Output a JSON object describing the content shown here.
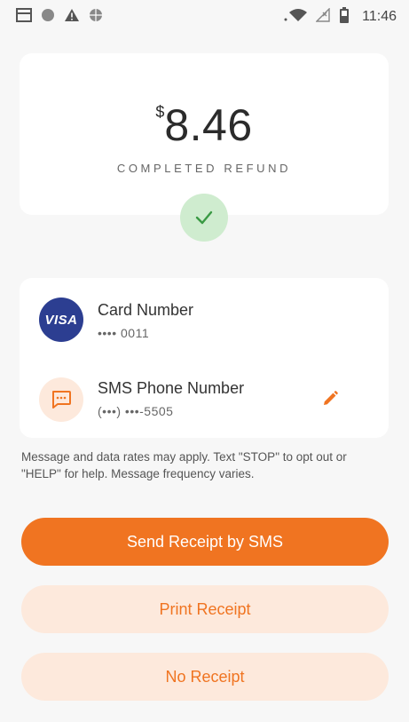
{
  "status_bar": {
    "time": "11:46",
    "icons": [
      "notification-card-icon",
      "dot-icon",
      "warning-icon",
      "globe-icon",
      "wifi-icon",
      "no-signal-icon",
      "battery-icon"
    ]
  },
  "amount": {
    "currency": "$",
    "value": "8.46",
    "label": "COMPLETED REFUND"
  },
  "card": {
    "brand": "VISA",
    "title": "Card Number",
    "number": "•••• 0011"
  },
  "sms": {
    "title": "SMS Phone Number",
    "number": "(•••) •••-5505"
  },
  "disclaimer": "Message and data rates may apply. Text \"STOP\" to opt out or \"HELP\" for help. Message frequency varies.",
  "buttons": {
    "send_sms": "Send Receipt by SMS",
    "print": "Print Receipt",
    "none": "No Receipt"
  },
  "colors": {
    "accent": "#f07421",
    "accent_light": "#fde9dc",
    "success_bg": "#cfeccf",
    "success": "#3a9a44",
    "visa": "#2c3e91"
  }
}
